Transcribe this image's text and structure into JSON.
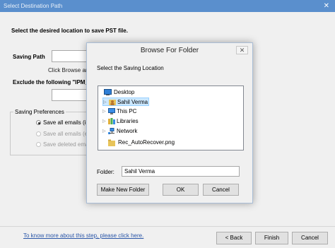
{
  "window": {
    "title": "Select Destination Path",
    "close_glyph": "✕"
  },
  "main": {
    "instruction": "Select the desired location to save PST file.",
    "saving_path_label": "Saving Path",
    "saving_path_value": "",
    "click_browse_partial": "Click Browse an",
    "exclude_label": "Exclude the following \"IPM_S",
    "exclude_value": "",
    "prefs_group_title": "Saving Preferences",
    "options": [
      {
        "label": "Save all emails (i",
        "selected": true,
        "enabled": true
      },
      {
        "label": "Save all emails (e",
        "selected": false,
        "enabled": false
      },
      {
        "label": "Save deleted ema",
        "selected": false,
        "enabled": false
      }
    ]
  },
  "footer": {
    "help_link": "To know more about this step, please click here.",
    "back_label": "< Back",
    "finish_label": "Finish",
    "cancel_label": "Cancel"
  },
  "dialog": {
    "title": "Browse For Folder",
    "close_glyph": "✕",
    "prompt": "Select the Saving Location",
    "tree": [
      {
        "label": "Desktop",
        "icon": "desktop-icon",
        "expander": ""
      },
      {
        "label": "Sahil Verma",
        "icon": "user-folder-icon",
        "expander": "▷",
        "selected": true
      },
      {
        "label": "This PC",
        "icon": "computer-icon",
        "expander": "▷"
      },
      {
        "label": "Libraries",
        "icon": "libraries-icon",
        "expander": "▷"
      },
      {
        "label": "Network",
        "icon": "network-icon",
        "expander": "▷"
      },
      {
        "label": "Rec_AutoRecover.png",
        "icon": "file-icon",
        "expander": ""
      }
    ],
    "folder_label": "Folder:",
    "folder_value": "Sahil Verma",
    "make_new_folder": "Make New Folder",
    "ok_label": "OK",
    "cancel_label": "Cancel"
  },
  "colors": {
    "titlebar": "#5a8fcd",
    "selection": "#cce8ff",
    "link": "#2a56a8"
  }
}
